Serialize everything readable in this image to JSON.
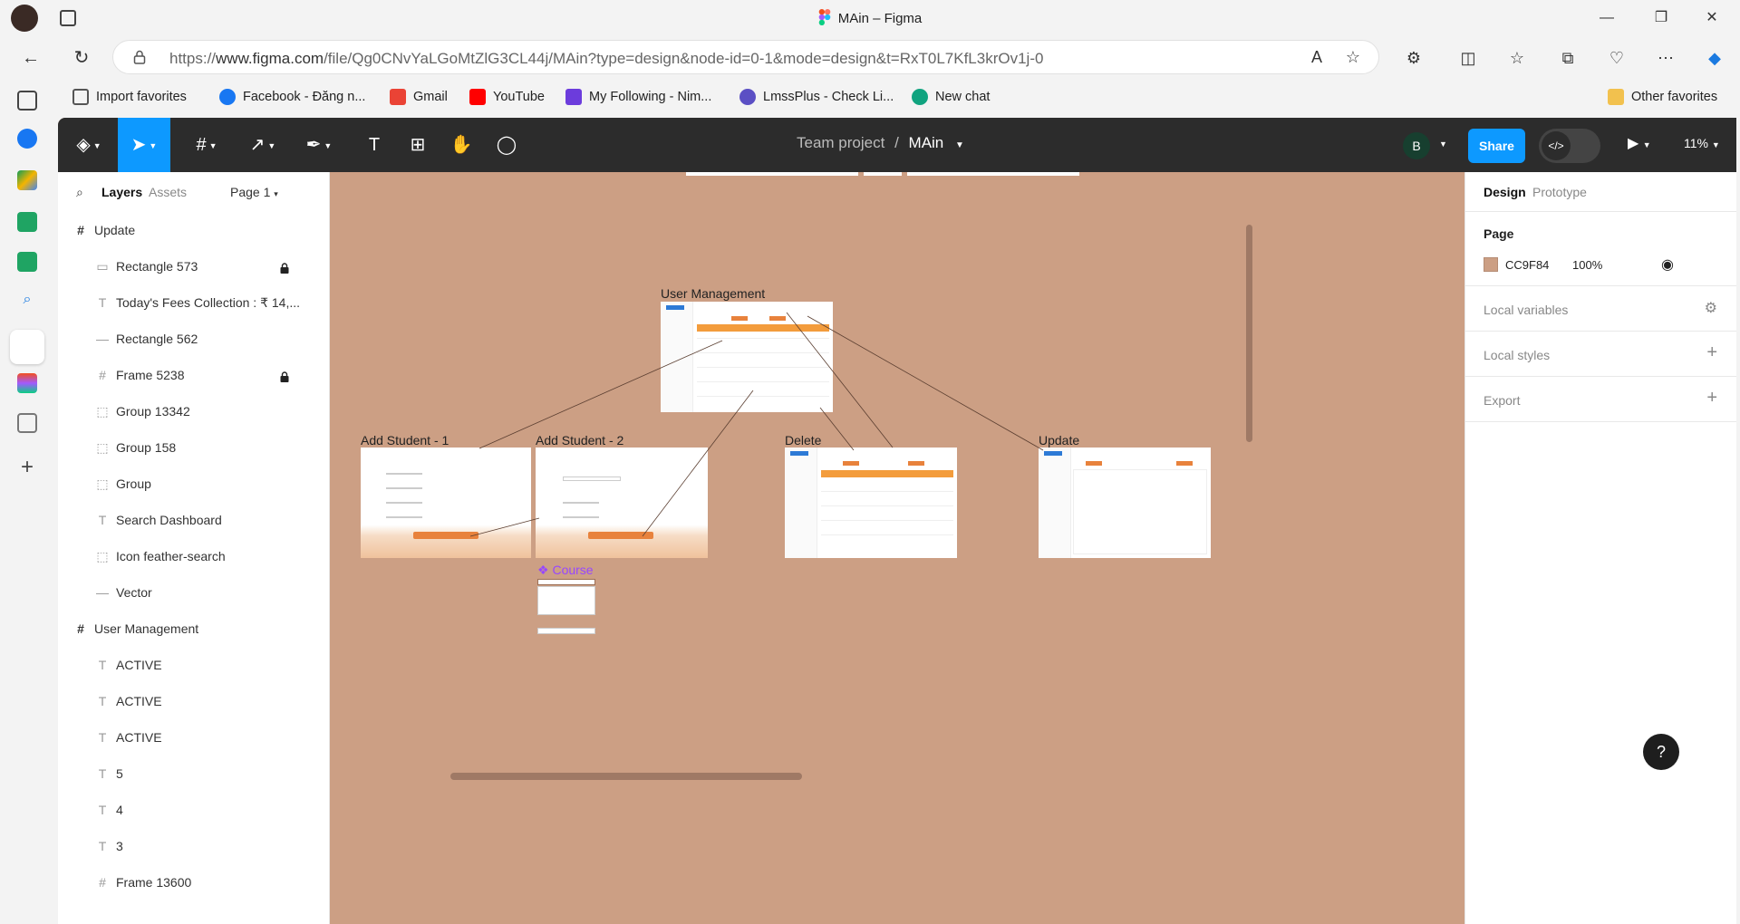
{
  "window": {
    "title": "MAin – Figma",
    "minimize": "—",
    "maximize": "❐",
    "close": "✕"
  },
  "address": {
    "url_prefix": "https://",
    "url_host": "www.figma.com",
    "url_path": "/file/Qg0CNvYaLGoMtZlG3CL44j/MAin?type=design&node-id=0-1&mode=design&t=RxT0L7KfL3krOv1j-0"
  },
  "favorites": [
    {
      "label": "Import favorites",
      "color": "#555555"
    },
    {
      "label": "Facebook - Đăng n...",
      "color": "#1877f2"
    },
    {
      "label": "Gmail",
      "color": "#ea4335"
    },
    {
      "label": "YouTube",
      "color": "#ff0000"
    },
    {
      "label": "My Following - Nim...",
      "color": "#6c3cdc"
    },
    {
      "label": "LmssPlus - Check Li...",
      "color": "#5b4fc4"
    },
    {
      "label": "New chat",
      "color": "#10a37f"
    }
  ],
  "other_favorites": "Other favorites",
  "figma": {
    "breadcrumb_team": "Team project",
    "breadcrumb_sep": "/",
    "file_name": "MAin",
    "user_initial": "B",
    "share_label": "Share",
    "dev_icon": "</>",
    "zoom": "11%",
    "left_tabs": {
      "layers": "Layers",
      "assets": "Assets",
      "page": "Page 1"
    },
    "layers": [
      {
        "name": "Update",
        "icon": "#",
        "level": 0,
        "locked": false
      },
      {
        "name": "Rectangle 573",
        "icon": "▭",
        "level": 1,
        "locked": true
      },
      {
        "name": "Today's Fees Collection : ₹ 14,...",
        "icon": "T",
        "level": 1,
        "locked": false
      },
      {
        "name": "Rectangle 562",
        "icon": "—",
        "level": 1,
        "locked": false
      },
      {
        "name": "Frame 5238",
        "icon": "#",
        "level": 1,
        "locked": true
      },
      {
        "name": "Group 13342",
        "icon": "⬚",
        "level": 1,
        "locked": false
      },
      {
        "name": "Group 158",
        "icon": "⬚",
        "level": 1,
        "locked": false
      },
      {
        "name": "Group",
        "icon": "⬚",
        "level": 1,
        "locked": false
      },
      {
        "name": "Search Dashboard",
        "icon": "T",
        "level": 1,
        "locked": false
      },
      {
        "name": "Icon feather-search",
        "icon": "⬚",
        "level": 1,
        "locked": false
      },
      {
        "name": "Vector",
        "icon": "—",
        "level": 1,
        "locked": false
      },
      {
        "name": "User Management",
        "icon": "#",
        "level": 0,
        "locked": false
      },
      {
        "name": "ACTIVE",
        "icon": "T",
        "level": 1,
        "locked": false
      },
      {
        "name": "ACTIVE",
        "icon": "T",
        "level": 1,
        "locked": false
      },
      {
        "name": "ACTIVE",
        "icon": "T",
        "level": 1,
        "locked": false
      },
      {
        "name": "5",
        "icon": "T",
        "level": 1,
        "locked": false
      },
      {
        "name": "4",
        "icon": "T",
        "level": 1,
        "locked": false
      },
      {
        "name": "3",
        "icon": "T",
        "level": 1,
        "locked": false
      },
      {
        "name": "Frame 13600",
        "icon": "#",
        "level": 1,
        "locked": false
      }
    ],
    "right_tabs": {
      "design": "Design",
      "prototype": "Prototype"
    },
    "page_section": {
      "title": "Page",
      "color_hex": "CC9F84",
      "opacity": "100%",
      "swatch": "#cc9f84"
    },
    "local_variables": "Local variables",
    "local_styles": "Local styles",
    "export": "Export",
    "canvas": {
      "frames": [
        {
          "label": "User Management"
        },
        {
          "label": "Add Student - 1"
        },
        {
          "label": "Add Student - 2"
        },
        {
          "label": "Delete"
        },
        {
          "label": "Update"
        },
        {
          "label": "Course"
        }
      ]
    },
    "help": "?"
  }
}
